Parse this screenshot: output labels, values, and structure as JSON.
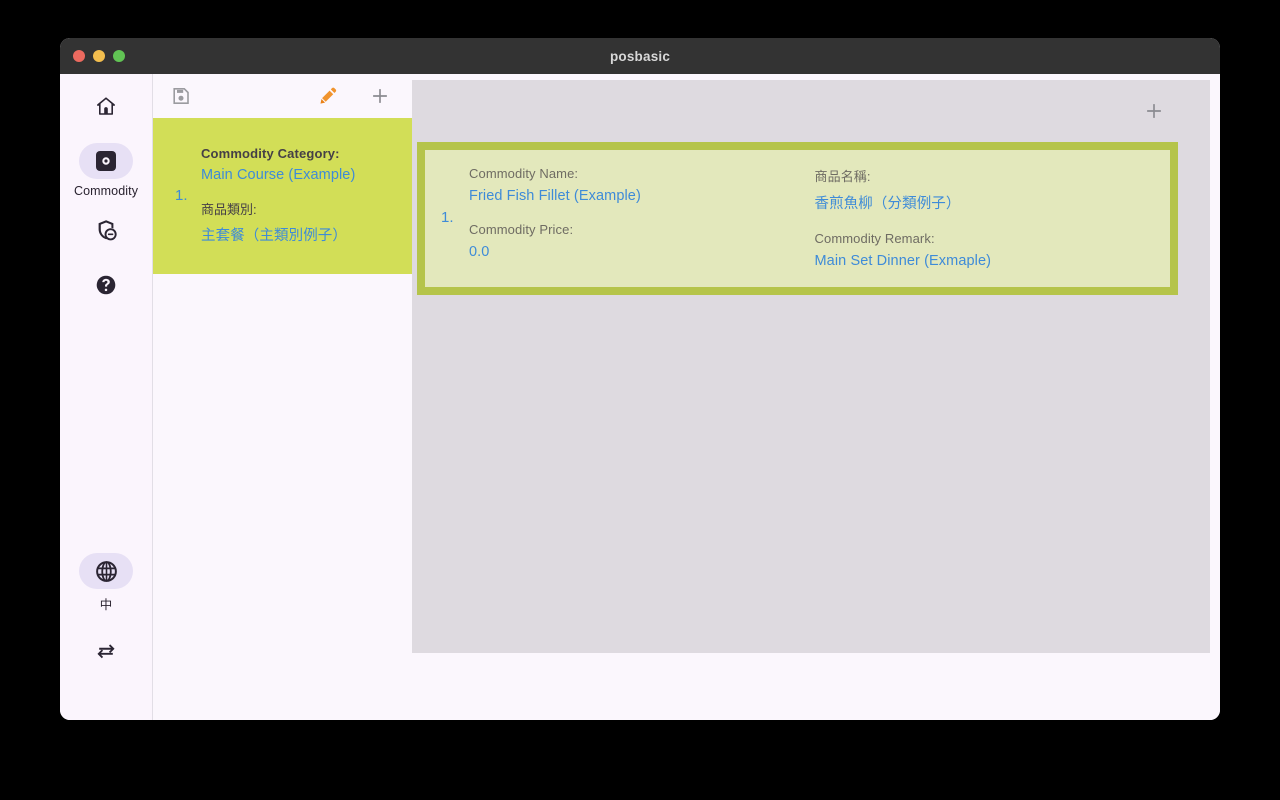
{
  "window": {
    "title": "posbasic",
    "traffic_lights": [
      "close-button",
      "minimize-button",
      "zoom-button"
    ]
  },
  "sidebar": {
    "items": [
      {
        "icon": "home-icon",
        "label": "",
        "name": "sidebar-item-home",
        "active": false
      },
      {
        "icon": "gear-icon",
        "label": "Commodity",
        "name": "sidebar-item-commodity",
        "active": true
      },
      {
        "icon": "shield-user-icon",
        "label": "",
        "name": "sidebar-item-security",
        "active": false
      },
      {
        "icon": "question-circle-icon",
        "label": "",
        "name": "sidebar-item-help",
        "active": false
      }
    ],
    "bottom": {
      "language": {
        "icon": "globe-icon",
        "label": "中",
        "name": "sidebar-language-toggle"
      },
      "swap": {
        "icon": "swap-arrows-icon",
        "label": "",
        "name": "sidebar-swap-button"
      }
    }
  },
  "left_panel": {
    "toolbar": {
      "save": {
        "icon": "save-icon",
        "label": ""
      },
      "edit": {
        "icon": "pencil-icon",
        "label": ""
      },
      "add": {
        "icon": "plus-icon",
        "label": ""
      }
    },
    "categories": [
      {
        "index": "1.",
        "label_en": "Commodity Category:",
        "value_en": "Main Course (Example)",
        "label_cn": "商品類別:",
        "value_cn": "主套餐（主類別例子）"
      }
    ]
  },
  "right_panel": {
    "toolbar": {
      "add": {
        "icon": "plus-icon",
        "label": ""
      }
    },
    "items": [
      {
        "index": "1.",
        "name_label": "Commodity Name:",
        "name_value": "Fried Fish Fillet (Example)",
        "name_label_cn": "商品名稱:",
        "name_value_cn": "香煎魚柳（分類例子）",
        "price_label": "Commodity Price:",
        "price_value": "0.0",
        "remark_label": "Commodity Remark:",
        "remark_value": "Main Set Dinner (Exmaple)"
      }
    ]
  },
  "colors": {
    "titlebar": "#333333",
    "sidebar_bg": "#FBF5FD",
    "active_pill": "#E7E0F5",
    "category_green": "#D2DE57",
    "card_border_olive": "#B5C44A",
    "card_inner": "#E3E8BC",
    "detail_bg": "#DEDAE0",
    "link_blue": "#3E8BD8",
    "pencil_orange": "#F0942E"
  }
}
